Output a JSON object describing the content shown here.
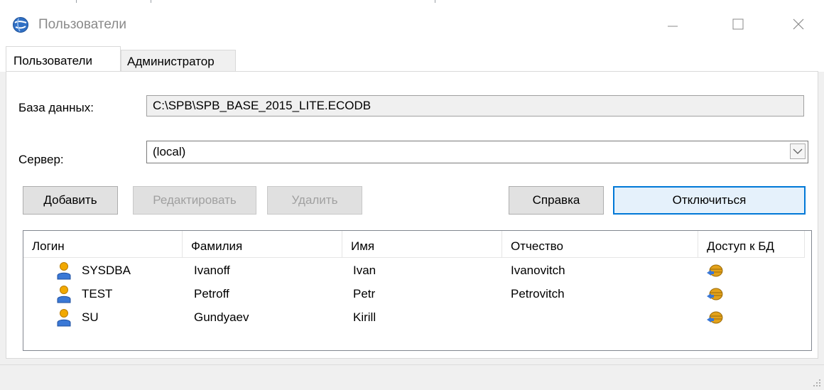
{
  "window": {
    "title": "Пользователи",
    "minimize_glyph": "—",
    "close_glyph": "✕"
  },
  "tabs": [
    {
      "label": "Пользователи",
      "active": true
    },
    {
      "label": "Администратор",
      "active": false
    }
  ],
  "form": {
    "database_label": "База данных:",
    "database_value": "C:\\SPB\\SPB_BASE_2015_LITE.ECODB",
    "server_label": "Сервер:",
    "server_value": "(local)"
  },
  "buttons": {
    "add": "Добавить",
    "edit": "Редактировать",
    "delete": "Удалить",
    "help": "Справка",
    "disconnect": "Отключиться"
  },
  "users_table": {
    "columns": [
      "Логин",
      "Фамилия",
      "Имя",
      "Отчество",
      "Доступ к БД"
    ],
    "rows": [
      {
        "login": "SYSDBA",
        "last_name": "Ivanoff",
        "first_name": "Ivan",
        "patronymic": "Ivanovitch",
        "db_access_icon": "db-access-icon"
      },
      {
        "login": "TEST",
        "last_name": "Petroff",
        "first_name": "Petr",
        "patronymic": "Petrovitch",
        "db_access_icon": "db-access-icon"
      },
      {
        "login": "SU",
        "last_name": "Gundyaev",
        "first_name": "Kirill",
        "patronymic": "",
        "db_access_icon": "db-access-icon"
      }
    ]
  },
  "icons": {
    "app": "globe-app-icon",
    "user": "user-icon",
    "db_access": "db-access-icon"
  },
  "colors": {
    "accent": "#0078d7",
    "user_icon_head": "#f2a900",
    "user_icon_body": "#3a78d6",
    "db_icon": "#e3a21a"
  }
}
